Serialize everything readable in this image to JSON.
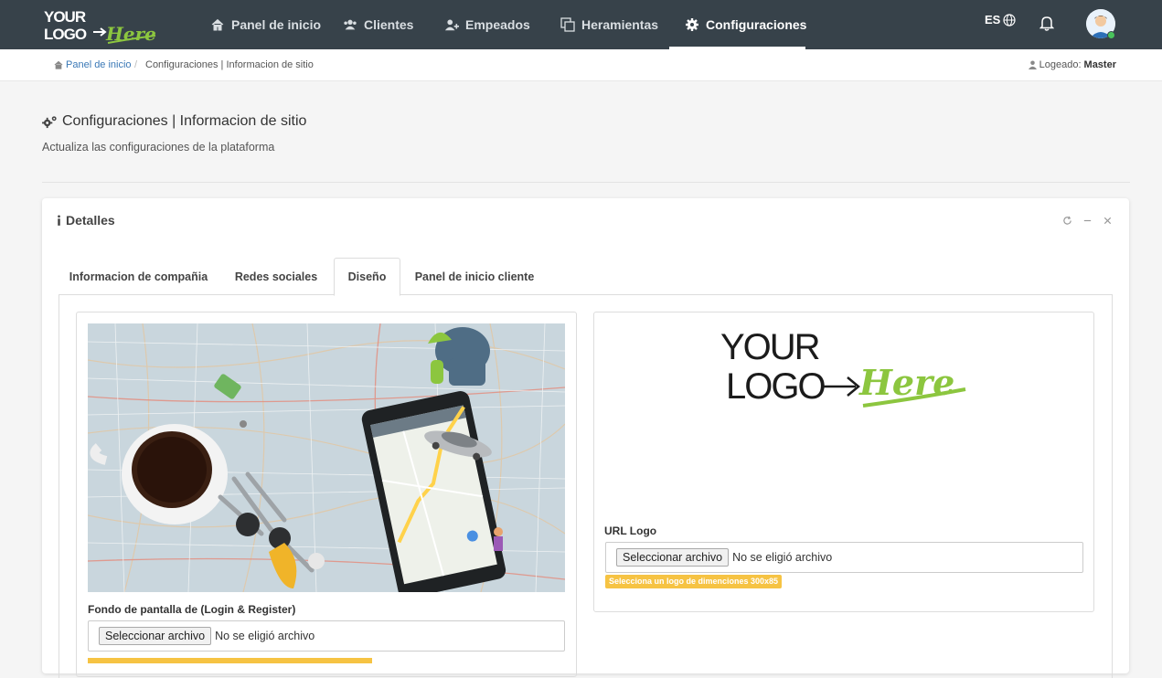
{
  "nav": {
    "items": [
      {
        "label": "Panel de inicio",
        "icon": "home-icon"
      },
      {
        "label": "Clientes",
        "icon": "users-icon"
      },
      {
        "label": "Empeados",
        "icon": "user-plus-icon"
      },
      {
        "label": "Heramientas",
        "icon": "clone-icon"
      },
      {
        "label": "Configuraciones",
        "icon": "gear-icon",
        "active": true
      }
    ],
    "language": "ES",
    "colors": {
      "bar": "#37424a",
      "active": "#ffffff"
    }
  },
  "breadcrumb": {
    "home": "Panel de inicio",
    "separator": "/",
    "current": "Configuraciones | Informacion de sitio",
    "logged_label": "Logeado:",
    "logged_user": "Master"
  },
  "page": {
    "title": "Configuraciones | Informacion de sitio",
    "subtitle": "Actualiza las configuraciones de la plataforma"
  },
  "card": {
    "title": "Detalles",
    "tabs": [
      {
        "label": "Informacion de compañia"
      },
      {
        "label": "Redes sociales"
      },
      {
        "label": "Diseño",
        "active": true
      },
      {
        "label": "Panel de inicio cliente"
      }
    ],
    "background": {
      "label": "Fondo de pantalla de (Login & Register)",
      "button": "Seleccionar archivo",
      "no_file": "No se eligió archivo"
    },
    "logo": {
      "label": "URL Logo",
      "button": "Seleccionar archivo",
      "no_file": "No se eligió archivo",
      "hint": "Selecciona un logo de dimenciones 300x85",
      "hint_color": "#f6c343"
    }
  }
}
